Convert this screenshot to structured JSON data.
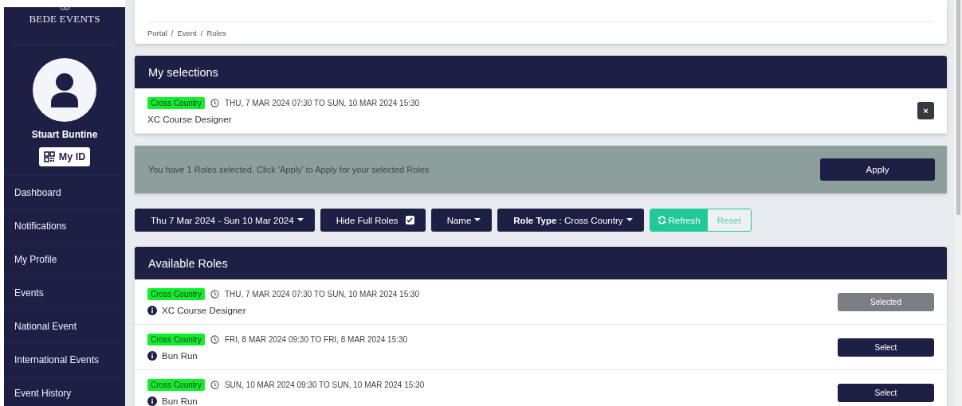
{
  "logo": {
    "text": "BEDE EVENTS"
  },
  "user": {
    "name": "Stuart Buntine",
    "id_button": "My ID"
  },
  "sidebar": {
    "items": [
      "Dashboard",
      "Notifications",
      "My Profile",
      "Events",
      "National Event",
      "International Events",
      "Event History"
    ]
  },
  "breadcrumb": {
    "items": [
      "Portal",
      "Event",
      "Roles"
    ],
    "separator": "/"
  },
  "my_selections": {
    "title": "My selections",
    "items": [
      {
        "tag": "Cross Country",
        "time": "THU, 7 MAR 2024 07:30 TO SUN, 10 MAR 2024 15:30",
        "role": "XC Course Designer",
        "remove_button": "×"
      }
    ]
  },
  "notice": {
    "text": "You have 1 Roles selected. Click 'Apply' to Apply for your selected Roles",
    "button": "Apply"
  },
  "filters": [
    {
      "kind": "dropdown",
      "label": "Thu 7 Mar 2024 - Sun 10 Mar 2024"
    },
    {
      "kind": "checkbox",
      "label": "Hide Full Roles",
      "checked": true
    },
    {
      "kind": "dropdown",
      "label": "Name"
    },
    {
      "kind": "dropdown",
      "label": "**Role Type** : Cross Country"
    }
  ],
  "refresh_button": "Refresh",
  "reset_button": "Reset",
  "available_roles": {
    "title": "Available Roles",
    "rows": [
      {
        "tag": "Cross Country",
        "time": "THU, 7 MAR 2024 07:30 TO SUN, 10 MAR 2024 15:30",
        "role": "XC Course Designer",
        "action": "Selected",
        "selected": true
      },
      {
        "tag": "Cross Country",
        "time": "FRI, 8 MAR 2024 09:30 TO FRI, 8 MAR 2024 15:30",
        "role": "Bun Run",
        "action": "Select",
        "selected": false
      },
      {
        "tag": "Cross Country",
        "time": "SUN, 10 MAR 2024 09:30 TO SUN, 10 MAR 2024 15:30",
        "role": "Bun Run",
        "action": "Select",
        "selected": false
      }
    ]
  }
}
